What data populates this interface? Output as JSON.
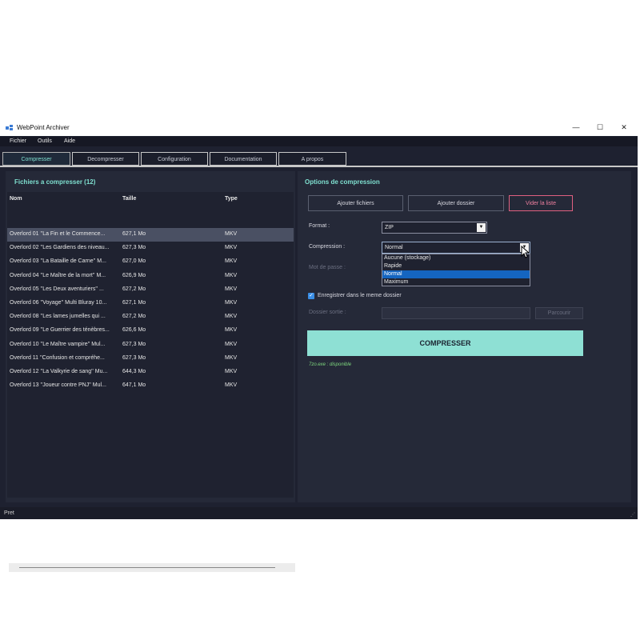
{
  "window": {
    "title": "WebPoint Archiver",
    "minimize": "—",
    "maximize": "☐",
    "close": "✕"
  },
  "menu": [
    "Fichier",
    "Outils",
    "Aide"
  ],
  "tabs": [
    "Compresser",
    "Decompresser",
    "Configuration",
    "Documentation",
    "A propos"
  ],
  "left": {
    "header": "Fichiers a compresser (12)",
    "columns": [
      "Nom",
      "Taille",
      "Type"
    ],
    "rows": [
      {
        "name": "Overlord 01 ''La Fin et le Commence...",
        "size": "627,1 Mo",
        "type": "MKV"
      },
      {
        "name": "Overlord 02 ''Les Gardiens des niveau...",
        "size": "627,3 Mo",
        "type": "MKV"
      },
      {
        "name": "Overlord 03 ''La Bataille de Carne'' M...",
        "size": "627,0 Mo",
        "type": "MKV"
      },
      {
        "name": "Overlord 04 ''Le Maître de la mort'' M...",
        "size": "626,9 Mo",
        "type": "MKV"
      },
      {
        "name": "Overlord 05 ''Les Deux aventuriers'' ...",
        "size": "627,2 Mo",
        "type": "MKV"
      },
      {
        "name": "Overlord 06 ''Voyage'' Multi Bluray 10...",
        "size": "627,1 Mo",
        "type": "MKV"
      },
      {
        "name": "Overlord 08 ''Les lames jumelles qui ...",
        "size": "627,2 Mo",
        "type": "MKV"
      },
      {
        "name": "Overlord 09 ''Le Guerrier des ténèbres...",
        "size": "626,6 Mo",
        "type": "MKV"
      },
      {
        "name": "Overlord 10 ''Le Maître vampire'' Mul...",
        "size": "627,3 Mo",
        "type": "MKV"
      },
      {
        "name": "Overlord 11 ''Confusion et compréhe...",
        "size": "627,3 Mo",
        "type": "MKV"
      },
      {
        "name": "Overlord 12 ''La Valkyrie de sang'' Mu...",
        "size": "644,3 Mo",
        "type": "MKV"
      },
      {
        "name": "Overlord 13 ''Joueur contre PNJ'' Mul...",
        "size": "647,1 Mo",
        "type": "MKV"
      }
    ]
  },
  "right": {
    "header": "Options de compression",
    "buttons": {
      "add_files": "Ajouter fichiers",
      "add_folder": "Ajouter dossier",
      "clear": "Vider la liste"
    },
    "format_label": "Format :",
    "format_value": "ZIP",
    "compression_label": "Compression :",
    "compression_value": "Normal",
    "compression_options": [
      "Aucune (stockage)",
      "Rapide",
      "Normal",
      "Maximum"
    ],
    "password_label": "Mot de passe :",
    "save_same_label": "Enregistrer dans le meme dossier",
    "output_label": "Dossier sortie :",
    "browse_label": "Parcourir",
    "compress_label": "COMPRESSER",
    "status_7z": "7zo.exe : disponible"
  },
  "statusbar": {
    "text": "Pret"
  },
  "colors": {
    "accent": "#7fe0d0",
    "compress_bg": "#8ee0d4",
    "clear_border": "#e06080",
    "selection": "#1565c0"
  }
}
